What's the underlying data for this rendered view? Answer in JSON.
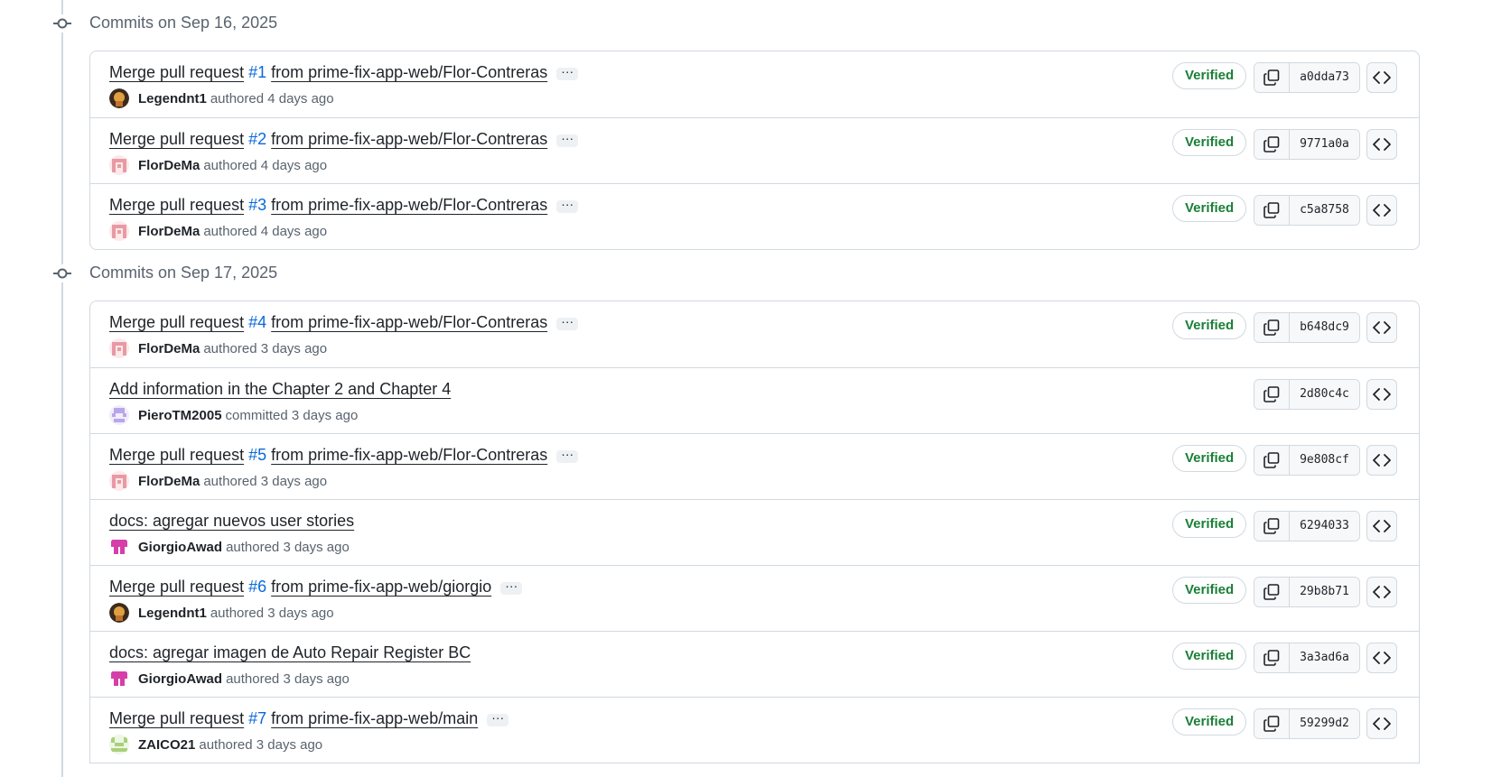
{
  "groups": [
    {
      "title": "Commits on Sep 16, 2025",
      "commits": [
        {
          "prefix": "Merge pull request",
          "pr": "#1",
          "suffix": "from prime-fix-app-web/Flor-Contreras",
          "has_ellipsis": true,
          "ellipsis": "···",
          "author": "Legendnt1",
          "avatar": "avatar-legendnt1",
          "action": "authored 4 days ago",
          "verified": "Verified",
          "sha": "a0dda73"
        },
        {
          "prefix": "Merge pull request",
          "pr": "#2",
          "suffix": "from prime-fix-app-web/Flor-Contreras",
          "has_ellipsis": true,
          "ellipsis": "···",
          "author": "FlorDeMa",
          "avatar": "avatar-flordema",
          "action": "authored 4 days ago",
          "verified": "Verified",
          "sha": "9771a0a"
        },
        {
          "prefix": "Merge pull request",
          "pr": "#3",
          "suffix": "from prime-fix-app-web/Flor-Contreras",
          "has_ellipsis": true,
          "ellipsis": "···",
          "author": "FlorDeMa",
          "avatar": "avatar-flordema",
          "action": "authored 4 days ago",
          "verified": "Verified",
          "sha": "c5a8758"
        }
      ]
    },
    {
      "title": "Commits on Sep 17, 2025",
      "commits": [
        {
          "prefix": "Merge pull request",
          "pr": "#4",
          "suffix": "from prime-fix-app-web/Flor-Contreras",
          "has_ellipsis": true,
          "ellipsis": "···",
          "author": "FlorDeMa",
          "avatar": "avatar-flordema",
          "action": "authored 3 days ago",
          "verified": "Verified",
          "sha": "b648dc9"
        },
        {
          "prefix": "Add information in the Chapter 2 and Chapter 4",
          "pr": "",
          "suffix": "",
          "has_ellipsis": false,
          "ellipsis": "",
          "author": "PieroTM2005",
          "avatar": "avatar-pierotm",
          "action": "committed 3 days ago",
          "verified": "",
          "sha": "2d80c4c"
        },
        {
          "prefix": "Merge pull request",
          "pr": "#5",
          "suffix": "from prime-fix-app-web/Flor-Contreras",
          "has_ellipsis": true,
          "ellipsis": "···",
          "author": "FlorDeMa",
          "avatar": "avatar-flordema",
          "action": "authored 3 days ago",
          "verified": "Verified",
          "sha": "9e808cf"
        },
        {
          "prefix": "docs: agregar nuevos user stories",
          "pr": "",
          "suffix": "",
          "has_ellipsis": false,
          "ellipsis": "",
          "author": "GiorgioAwad",
          "avatar": "avatar-giorgio",
          "action": "authored 3 days ago",
          "verified": "Verified",
          "sha": "6294033"
        },
        {
          "prefix": "Merge pull request",
          "pr": "#6",
          "suffix": "from prime-fix-app-web/giorgio",
          "has_ellipsis": true,
          "ellipsis": "···",
          "author": "Legendnt1",
          "avatar": "avatar-legendnt1",
          "action": "authored 3 days ago",
          "verified": "Verified",
          "sha": "29b8b71"
        },
        {
          "prefix": "docs: agregar imagen de Auto Repair Register BC",
          "pr": "",
          "suffix": "",
          "has_ellipsis": false,
          "ellipsis": "",
          "author": "GiorgioAwad",
          "avatar": "avatar-giorgio",
          "action": "authored 3 days ago",
          "verified": "Verified",
          "sha": "3a3ad6a"
        },
        {
          "prefix": "Merge pull request",
          "pr": "#7",
          "suffix": "from prime-fix-app-web/main",
          "has_ellipsis": true,
          "ellipsis": "···",
          "author": "ZAICO21",
          "avatar": "avatar-zaico",
          "action": "authored 3 days ago",
          "verified": "Verified",
          "sha": "59299d2"
        }
      ]
    }
  ],
  "colors": {
    "verified": "#1a7f37",
    "pr_link": "#0969da",
    "border": "#d1d9e0",
    "muted": "#59636e"
  }
}
